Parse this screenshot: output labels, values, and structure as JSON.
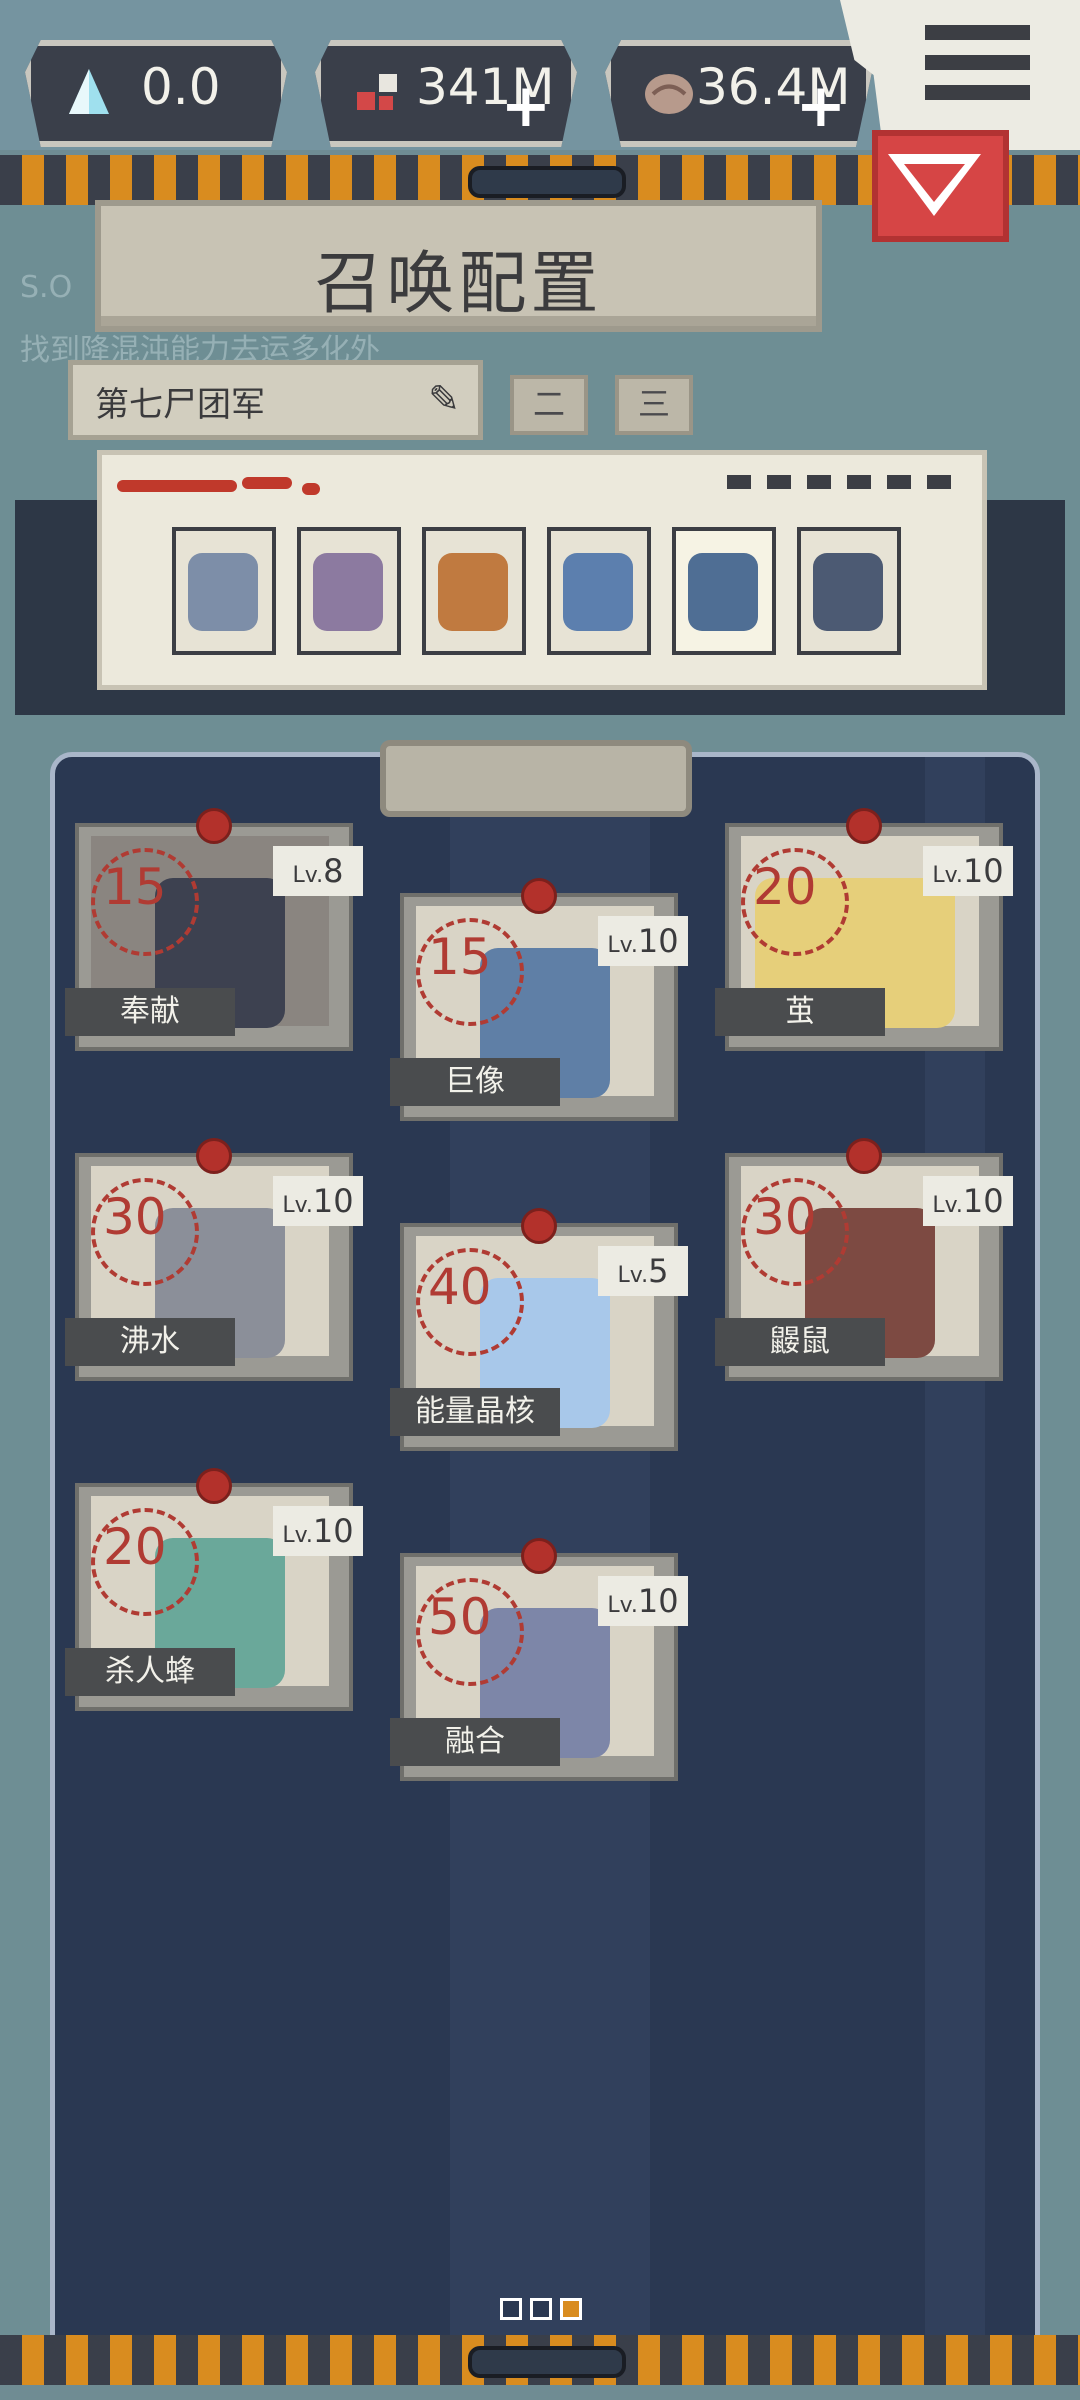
{
  "resources": {
    "crystal": {
      "value": "0.0",
      "icon": "crystal-icon"
    },
    "blood": {
      "value": "341M",
      "icon": "blood-icon"
    },
    "brain": {
      "value": "36.4M",
      "icon": "brain-icon"
    }
  },
  "header": {
    "title": "召唤配置",
    "bg_hint_1": "S.O",
    "bg_hint_2": "找到降混沌能力去运多化外"
  },
  "troop": {
    "name": "第七尸团军",
    "page2": "二",
    "page3": "三"
  },
  "cards": [
    {
      "name": "奉献",
      "cost": "15",
      "level_prefix": "Lv.",
      "level": "8"
    },
    {
      "name": "巨像",
      "cost": "15",
      "level_prefix": "Lv.",
      "level": "10"
    },
    {
      "name": "茧",
      "cost": "20",
      "level_prefix": "Lv.",
      "level": "10"
    },
    {
      "name": "沸水",
      "cost": "30",
      "level_prefix": "Lv.",
      "level": "10"
    },
    {
      "name": "能量晶核",
      "cost": "40",
      "level_prefix": "Lv.",
      "level": "5"
    },
    {
      "name": "鼹鼠",
      "cost": "30",
      "level_prefix": "Lv.",
      "level": "10"
    },
    {
      "name": "杀人蜂",
      "cost": "20",
      "level_prefix": "Lv.",
      "level": "10"
    },
    {
      "name": "融合",
      "cost": "50",
      "level_prefix": "Lv.",
      "level": "10"
    }
  ],
  "colors": {
    "accent_red": "#b03b33",
    "panel": "#2a3852",
    "paper": "#ece9dc",
    "stripe_orange": "#d98c1f"
  }
}
